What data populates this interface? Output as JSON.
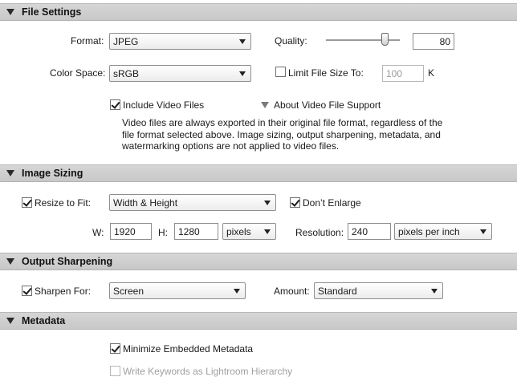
{
  "file_settings": {
    "title": "File Settings",
    "format_label": "Format:",
    "format_value": "JPEG",
    "quality_label": "Quality:",
    "quality_value": "80",
    "quality_fraction": 0.8,
    "color_space_label": "Color Space:",
    "color_space_value": "sRGB",
    "limit_label": "Limit File Size To:",
    "limit_value": "100",
    "limit_unit": "K",
    "include_video_label": "Include Video Files",
    "about_video_label": "About Video File Support",
    "video_desc_lines": [
      "Video files are always exported in their original file format, regardless of the",
      "file format selected above. Image sizing, output sharpening, metadata, and",
      "watermarking options are not applied to video files."
    ]
  },
  "image_sizing": {
    "title": "Image Sizing",
    "resize_label": "Resize to Fit:",
    "resize_value": "Width & Height",
    "dont_enlarge_label": "Don’t Enlarge",
    "w_label": "W:",
    "w_value": "1920",
    "h_label": "H:",
    "h_value": "1280",
    "unit_value": "pixels",
    "resolution_label": "Resolution:",
    "resolution_value": "240",
    "resolution_unit_value": "pixels per inch"
  },
  "output_sharpening": {
    "title": "Output Sharpening",
    "sharpen_label": "Sharpen For:",
    "sharpen_value": "Screen",
    "amount_label": "Amount:",
    "amount_value": "Standard"
  },
  "metadata": {
    "title": "Metadata",
    "minimize_label": "Minimize Embedded Metadata",
    "keywords_label": "Write Keywords as Lightroom Hierarchy"
  }
}
